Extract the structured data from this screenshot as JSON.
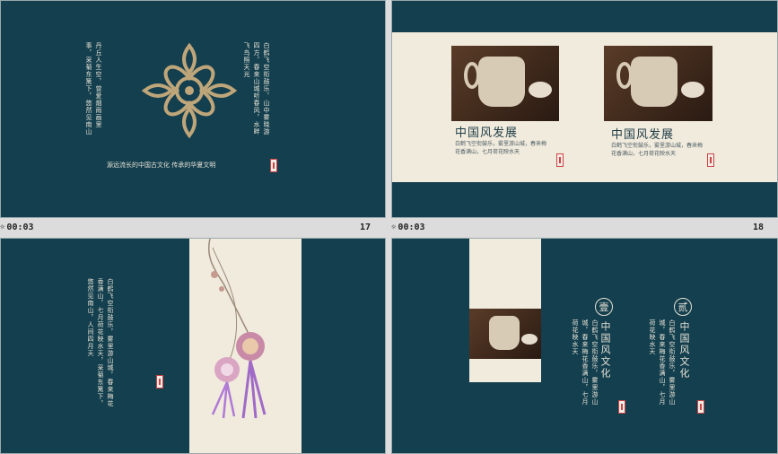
{
  "slides": [
    {
      "number": "17",
      "timing": "00:03",
      "caption": "源远流长的中国古文化   传承的华夏文明",
      "poem_right": "白鹤飞空衔鼓乐，山中雾晓游四方，春来山城听春风，水畔飞鸟照天光",
      "poem_left": "丹丘人生空，曾爱烟雨画里事，采菊东篱下，悠然见南山"
    },
    {
      "number": "18",
      "timing": "00:03",
      "cards": [
        {
          "title": "中国风发展",
          "text": "白鹤飞空衔鼓乐，雾里游山城，春来梅花香满山，七月荷花映水天"
        },
        {
          "title": "中国风发展",
          "text": "白鹤飞空衔鼓乐，雾里游山城，春来梅花香满山，七月荷花映水天"
        }
      ]
    },
    {
      "poem": "白鹤飞空衔鼓乐，雾里游山城，春来梅花香满山，七月荷花映水天，采菊东篱下，悠然见南山，人间四月天"
    },
    {
      "items": [
        {
          "badge": "壹",
          "title": "中国风文化",
          "text": "白鹤飞空衔鼓乐，雾里游山城，春来梅花香满山，七月荷花映水天"
        },
        {
          "badge": "贰",
          "title": "中国风文化",
          "text": "白鹤飞空衔鼓乐，雾里游山城，春来梅花香满山，七月荷花映水天"
        }
      ]
    }
  ],
  "colors": {
    "teal": "#143f4e",
    "cream": "#f1ebdd",
    "gold": "#bfa67a"
  },
  "icons": {
    "timing": "clock-icon"
  }
}
